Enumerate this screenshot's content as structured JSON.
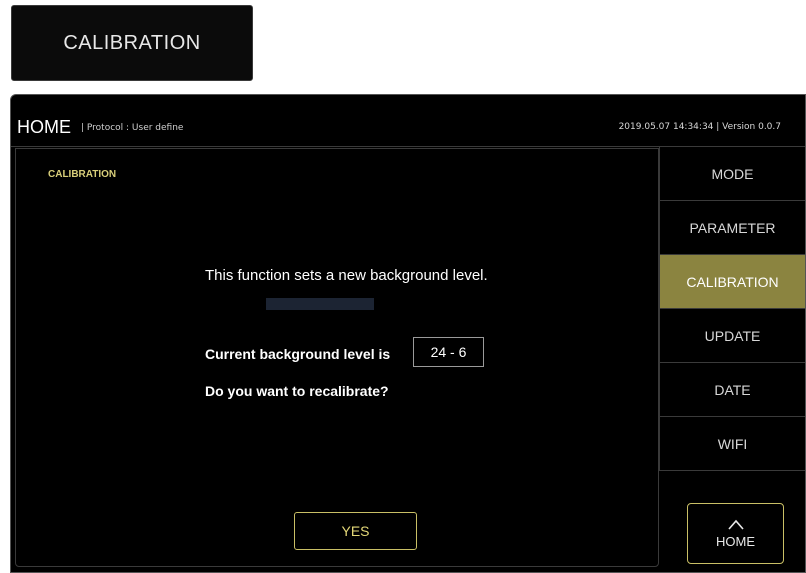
{
  "top_tab": {
    "label": "CALIBRATION"
  },
  "header": {
    "home": "HOME",
    "protocol": "| Protocol : User define",
    "status": "2019.05.07 14:34:34  |  Version 0.0.7"
  },
  "main": {
    "section_title": "CALIBRATION",
    "intro": "This function sets a new background level.",
    "current_label": "Current background level is",
    "current_value": "24 - 6",
    "question": "Do you want to recalibrate?",
    "yes_label": "YES"
  },
  "sidebar": {
    "items": [
      {
        "label": "MODE"
      },
      {
        "label": "PARAMETER"
      },
      {
        "label": "CALIBRATION"
      },
      {
        "label": "UPDATE"
      },
      {
        "label": "DATE"
      },
      {
        "label": "WIFI"
      }
    ],
    "active_index": 2,
    "home_label": "HOME",
    "home_icon": "home-icon"
  },
  "colors": {
    "accent": "#c9bf66",
    "active_bg": "#8b8440",
    "section_title": "#d9cf7a"
  }
}
